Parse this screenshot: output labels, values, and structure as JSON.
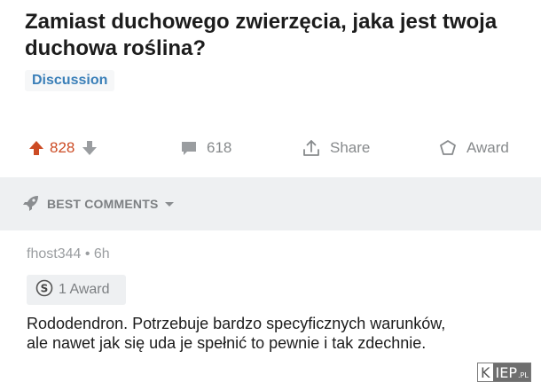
{
  "post": {
    "title": "Zamiast duchowego zwierzęcia, jaka jest twoja duchowa roślina?",
    "flair": "Discussion"
  },
  "actions": {
    "vote_count": "828",
    "comments_count": "618",
    "share_label": "Share",
    "award_label": "Award"
  },
  "sort": {
    "label": "BEST COMMENTS"
  },
  "comment": {
    "meta": "fhost344 • 6h",
    "award_text": "1 Award",
    "body": "Rododendron. Potrzebuje bardzo specyficznych warunków, ale nawet jak się uda je spełnić to pewnie i tak zdechnie."
  },
  "watermark": {
    "k": "K",
    "iep": "IEP",
    "pl": ".PL"
  },
  "colors": {
    "upvote": "#cc4b24",
    "flair_text": "#3a7fb8",
    "muted": "#878a8c",
    "bar_bg": "#eef0f2"
  }
}
